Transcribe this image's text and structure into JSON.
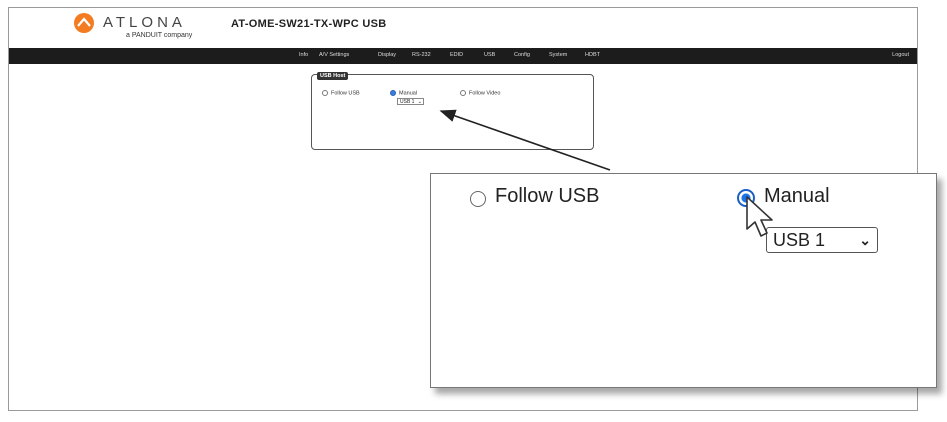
{
  "header": {
    "logo_text": "ATLONA",
    "logo_subtext": "a PANDUIT company",
    "device_title": "AT-OME-SW21-TX-WPC  USB"
  },
  "nav": {
    "items": [
      "Info",
      "A/V Settings",
      "Display",
      "RS-232",
      "EDID",
      "USB",
      "Config",
      "System",
      "HDBT"
    ],
    "logout": "Logout"
  },
  "usb_host": {
    "title": "USB Host",
    "options": [
      "Follow USB",
      "Manual",
      "Follow Video"
    ],
    "selected_option": "Manual",
    "select_value": "USB 1"
  },
  "zoom": {
    "follow_usb_label": "Follow USB",
    "manual_label": "Manual",
    "select_value": "USB 1"
  },
  "colors": {
    "navbar": "#1c1c1c",
    "radio_selected": "#1a73e8",
    "logo_orange": "#f47b20"
  },
  "icons": {
    "select_chevron": "chevron-down-icon",
    "pointer": "mouse-pointer-icon"
  }
}
